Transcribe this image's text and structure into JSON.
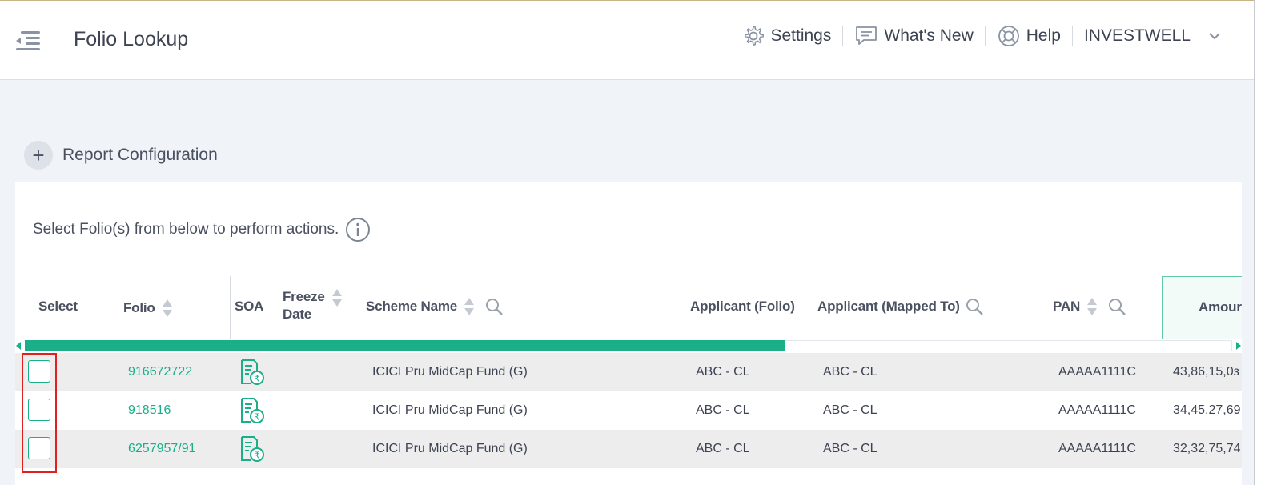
{
  "header": {
    "title": "Folio Lookup",
    "nav": {
      "settings": "Settings",
      "whats_new": "What's New",
      "help": "Help",
      "user": "INVESTWELL"
    }
  },
  "report_config": {
    "label": "Report Configuration"
  },
  "hint": {
    "text": "Select Folio(s) from below to perform actions."
  },
  "table": {
    "columns": {
      "select": "Select",
      "folio": "Folio",
      "soa": "SOA",
      "freeze_line1": "Freeze",
      "freeze_line2": "Date",
      "scheme": "Scheme Name",
      "applicant_folio": "Applicant (Folio)",
      "applicant_mapped": "Applicant (Mapped To)",
      "pan": "PAN",
      "amount": "Amour"
    },
    "scroll_position_fraction": 0.63,
    "rows": [
      {
        "folio": "916672722",
        "scheme": "ICICI Pru MidCap Fund (G)",
        "applicant_folio": "ABC - CL",
        "applicant_mapped": "ABC - CL",
        "pan": "AAAAA1111C",
        "amount": "43,86,15,0з"
      },
      {
        "folio": "918516",
        "scheme": "ICICI Pru MidCap Fund (G)",
        "applicant_folio": "ABC - CL",
        "applicant_mapped": "ABC - CL",
        "pan": "AAAAA1111C",
        "amount": "34,45,27,69"
      },
      {
        "folio": "6257957/91",
        "scheme": "ICICI Pru MidCap Fund (G)",
        "applicant_folio": "ABC - CL",
        "applicant_mapped": "ABC - CL",
        "pan": "AAAAA1111C",
        "amount": "32,32,75,74"
      }
    ]
  },
  "colors": {
    "accent": "#1aaf87",
    "highlight": "#e02020",
    "text": "#3d4352"
  }
}
